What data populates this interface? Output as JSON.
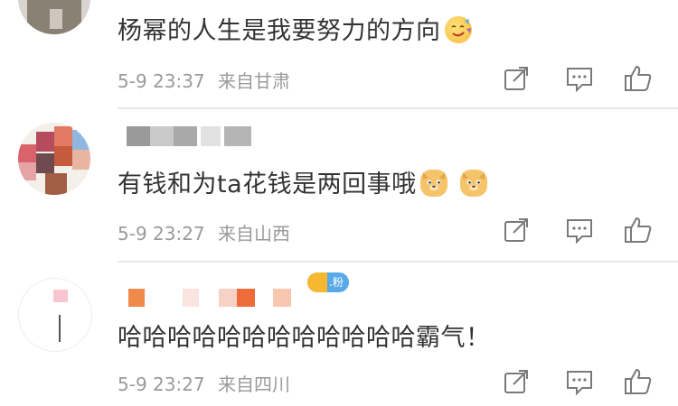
{
  "comments": [
    {
      "text": "杨幂的人生是我要努力的方向",
      "emoji": "hungry-face-emoji",
      "date": "5-9 23:37",
      "location": "来自甘肃"
    },
    {
      "text": "有钱和为ta花钱是两回事哦",
      "emoji": "doge-emoji",
      "date": "5-9 23:27",
      "location": "来自山西"
    },
    {
      "text": "哈哈哈哈哈哈哈哈哈哈哈哈霸气！",
      "badge": ".粉",
      "date": "5-9 23:27",
      "location": "来自四川"
    }
  ],
  "icons": {
    "share": "share-icon",
    "reply": "comment-icon",
    "like": "thumbs-up-icon"
  },
  "colors": {
    "text": "#333333",
    "meta": "#9a9a9a",
    "icon": "#7a7a7a",
    "badge": "#58a9e8"
  }
}
